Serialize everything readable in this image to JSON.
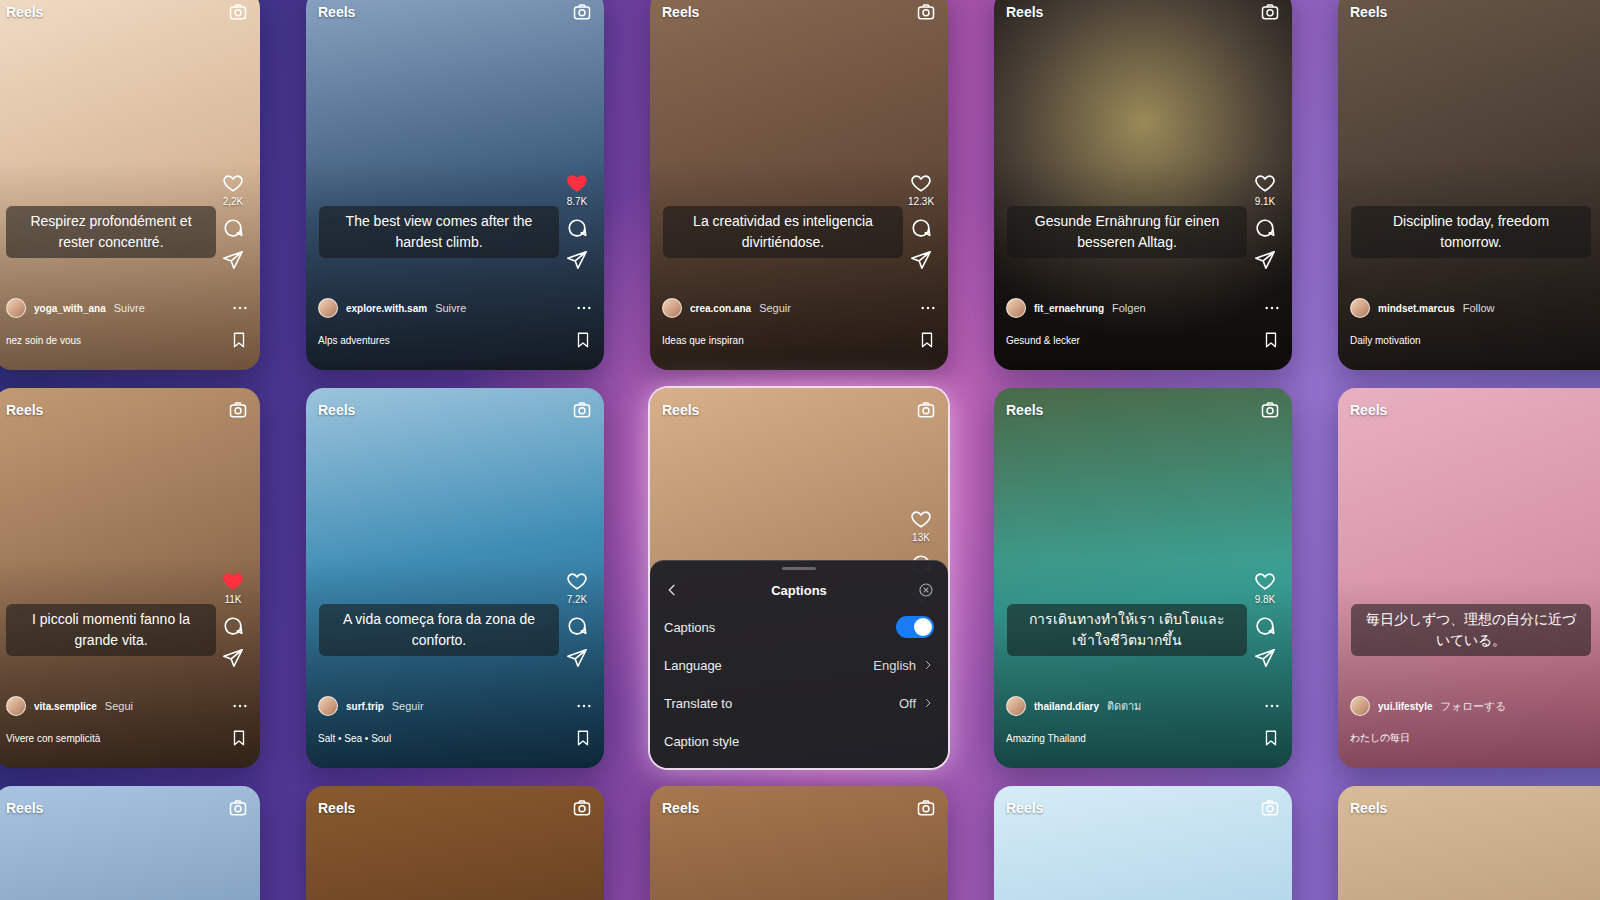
{
  "rows": [
    {
      "cards": [
        {
          "label": "Reels",
          "caption": "Respirez profondément et rester concentré.",
          "likes": "2,2K",
          "liked": false,
          "handle": "yoga_with_ana",
          "follow": "Suivre",
          "description": "nez soin de vous"
        },
        {
          "label": "Reels",
          "caption": "The best view comes after the hardest climb.",
          "likes": "8.7K",
          "liked": true,
          "handle": "explore.with.sam",
          "follow": "Suivre",
          "description": "Alps adventures"
        },
        {
          "label": "Reels",
          "caption": "La creatividad es inteligencia divirtiéndose.",
          "likes": "12.3K",
          "liked": false,
          "handle": "crea.con.ana",
          "follow": "Seguir",
          "description": "Ideas que inspiran"
        },
        {
          "label": "Reels",
          "caption": "Gesunde Ernährung für einen besseren Alltag.",
          "likes": "9.1K",
          "liked": false,
          "handle": "fit_ernaehrung",
          "follow": "Folgen",
          "description": "Gesund & lecker"
        },
        {
          "label": "Reels",
          "caption": "Discipline today, freedom tomorrow.",
          "handle": "mindset.marcus",
          "follow": "Follow",
          "description": "Daily motivation"
        }
      ]
    },
    {
      "cards": [
        {
          "label": "Reels",
          "caption": "I piccoli momenti fanno la grande vita.",
          "likes": "11K",
          "liked": true,
          "handle": "vita.semplice",
          "follow": "Segui",
          "description": "Vivere con semplicità"
        },
        {
          "label": "Reels",
          "caption": "A vida começa fora da zona de conforto.",
          "likes": "7.2K",
          "liked": false,
          "handle": "surf.trip",
          "follow": "Seguir",
          "description": "Salt • Sea • Soul"
        },
        {
          "label": "Reels",
          "likes": "13K",
          "liked": false,
          "panel": {
            "title": "Captions",
            "rows": [
              {
                "label": "Captions",
                "kind": "toggle",
                "on": true
              },
              {
                "label": "Language",
                "kind": "link",
                "value": "English"
              },
              {
                "label": "Translate to",
                "kind": "link",
                "value": "Off"
              },
              {
                "label": "Caption style",
                "kind": "plain"
              }
            ]
          }
        },
        {
          "label": "Reels",
          "caption": "การเดินทางทำให้เรา เติบโตและเข้าใจชีวิตมากขึ้น",
          "likes": "9.8K",
          "liked": false,
          "handle": "thailand.diary",
          "follow": "ติดตาม",
          "description": "Amazing Thailand"
        },
        {
          "label": "Reels",
          "caption": "毎日少しずつ、理想の自分に近づいている。",
          "handle": "yui.lifestyle",
          "follow": "フォローする",
          "description": "わたしの毎日"
        }
      ]
    },
    {
      "cards": [
        {
          "label": "Reels"
        },
        {
          "label": "Reels"
        },
        {
          "label": "Reels"
        },
        {
          "label": "Reels"
        },
        {
          "label": "Reels"
        }
      ]
    }
  ]
}
